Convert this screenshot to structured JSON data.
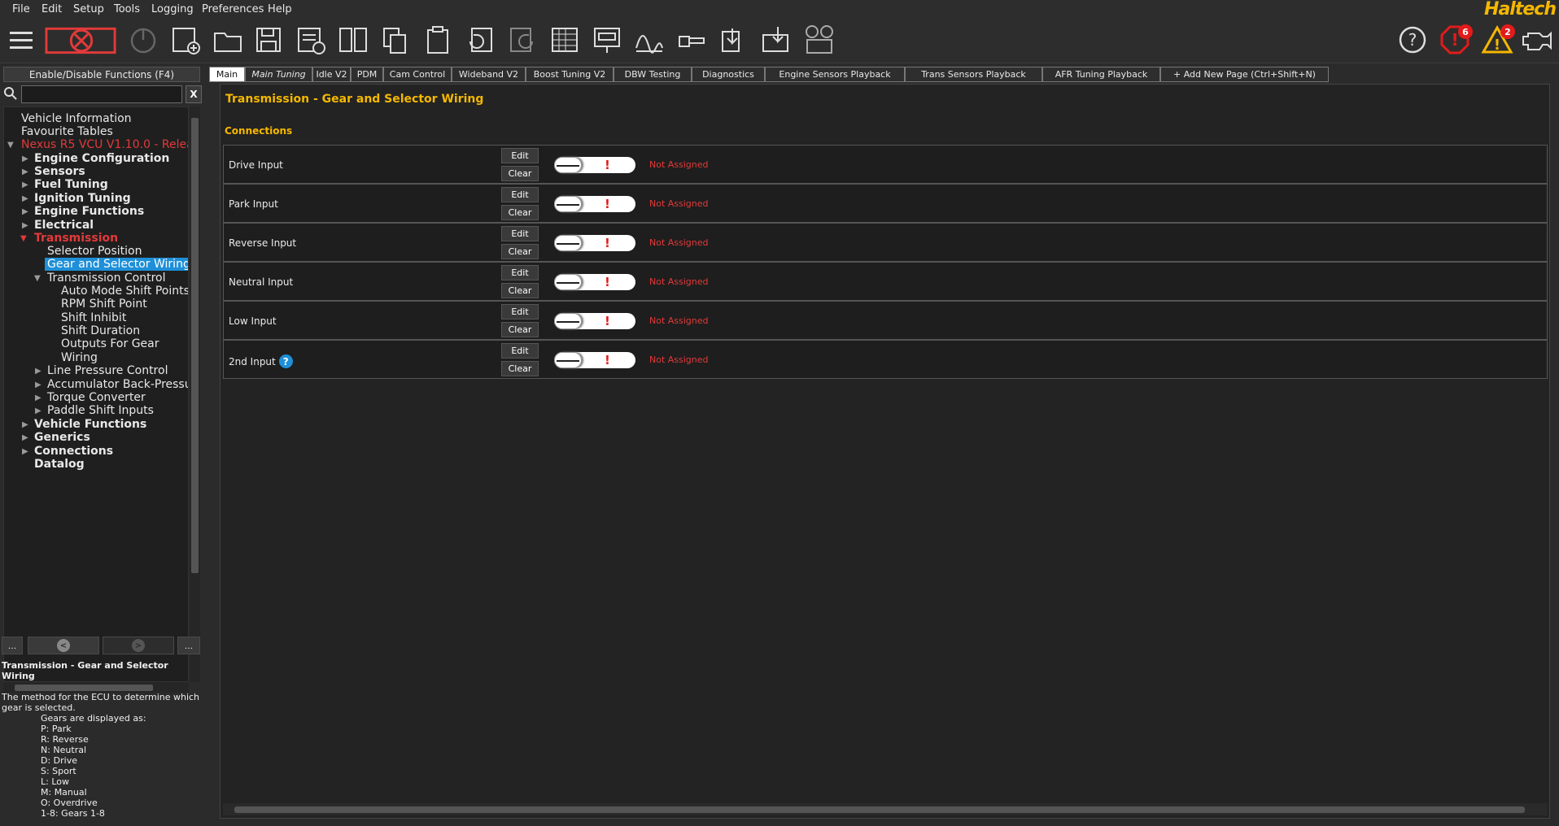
{
  "menu": {
    "items": [
      "File",
      "Edit",
      "Setup",
      "Tools",
      "Logging",
      "Preferences",
      "Help"
    ],
    "brand": "Haltech"
  },
  "toolbar": {
    "icons": [
      "hamburger-menu-icon",
      "disconnect-icon",
      "power-icon",
      "new-project-icon",
      "open-folder-icon",
      "save-icon",
      "export-icon",
      "compare-icon",
      "copy-icon",
      "paste-icon",
      "undo-icon",
      "redo-icon",
      "table-icon",
      "setup-wizard-icon",
      "graph-icon",
      "key-icon",
      "send-icon",
      "program-icon",
      "steering-icon"
    ],
    "errors_count": "6",
    "warnings_count": "2",
    "colors": {
      "accent": "#f5b800",
      "error": "#e21b1b",
      "disconnect": "#e23a3a"
    }
  },
  "left": {
    "enable_label": "Enable/Disable Functions (F4)",
    "search_placeholder": "",
    "search_clear": "X",
    "tree": {
      "vehicle_information": "Vehicle Information",
      "favourite_tables": "Favourite Tables",
      "device": "Nexus R5 VCU V1.10.0 - Release",
      "engine_configuration": "Engine Configuration",
      "sensors": "Sensors",
      "fuel_tuning": "Fuel Tuning",
      "ignition_tuning": "Ignition Tuning",
      "engine_functions": "Engine Functions",
      "electrical": "Electrical",
      "transmission": "Transmission",
      "selector_position": "Selector Position",
      "gear_and_selector_wiring": "Gear and Selector Wiring",
      "transmission_control": "Transmission Control",
      "auto_mode_shift_points": "Auto Mode Shift Points",
      "rpm_shift_point": "RPM Shift Point",
      "shift_inhibit": "Shift Inhibit",
      "shift_duration": "Shift Duration",
      "outputs_for_gear_1": "Outputs For Gear",
      "outputs_for_gear_2": "Wiring",
      "line_pressure_control": "Line Pressure Control",
      "accumulator_back_pressure": "Accumulator Back-Pressure",
      "torque_converter": "Torque Converter",
      "paddle_shift_inputs": "Paddle Shift Inputs",
      "vehicle_functions": "Vehicle Functions",
      "generics": "Generics",
      "connections": "Connections",
      "datalog": "Datalog"
    },
    "nav": {
      "more_left": "...",
      "more_right": "..."
    },
    "help": {
      "title": "Transmission - Gear and Selector Wiring",
      "description": "The method for the ECU to determine which gear is selected.",
      "gears_heading": "Gears are displayed as:",
      "gears": [
        "P: Park",
        "R: Reverse",
        "N: Neutral",
        "D: Drive",
        "S: Sport",
        "L: Low",
        "M: Manual",
        "O: Overdrive",
        "1-8: Gears 1-8"
      ]
    }
  },
  "tabs": [
    "Main",
    "Main Tuning",
    "Idle V2",
    "PDM",
    "Cam Control",
    "Wideband V2",
    "Boost Tuning V2",
    "DBW Testing",
    "Diagnostics",
    "Engine Sensors Playback",
    "Trans Sensors Playback",
    "AFR Tuning Playback",
    "+ Add New Page (Ctrl+Shift+N)"
  ],
  "main": {
    "title": "Transmission - Gear and Selector Wiring",
    "section": "Connections",
    "edit_label": "Edit",
    "clear_label": "Clear",
    "rows": [
      {
        "label": "Drive Input",
        "status": "Not Assigned"
      },
      {
        "label": "Park Input",
        "status": "Not Assigned"
      },
      {
        "label": "Reverse Input",
        "status": "Not Assigned"
      },
      {
        "label": "Neutral Input",
        "status": "Not Assigned"
      },
      {
        "label": "Low Input",
        "status": "Not Assigned"
      },
      {
        "label": "2nd Input",
        "status": "Not Assigned"
      }
    ],
    "toggle_mark": "!",
    "help_mark": "?"
  }
}
